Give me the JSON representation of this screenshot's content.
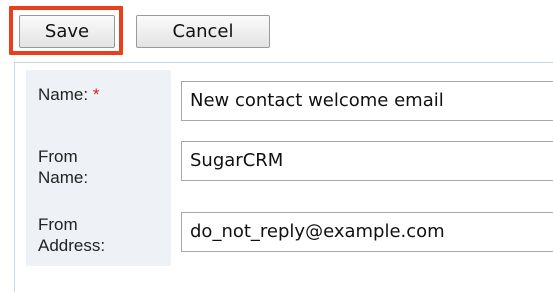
{
  "toolbar": {
    "save_label": "Save",
    "cancel_label": "Cancel"
  },
  "form": {
    "name": {
      "label": "Name:",
      "required_marker": "*",
      "value": "New contact welcome email"
    },
    "from_name": {
      "label_line1": "From",
      "label_line2": "Name:",
      "value": "SugarCRM"
    },
    "from_address": {
      "label_line1": "From",
      "label_line2": "Address:",
      "value": "do_not_reply@example.com"
    }
  },
  "colors": {
    "highlight": "#e8401c",
    "required": "#d61f1f",
    "label_background": "#eef2f6"
  }
}
